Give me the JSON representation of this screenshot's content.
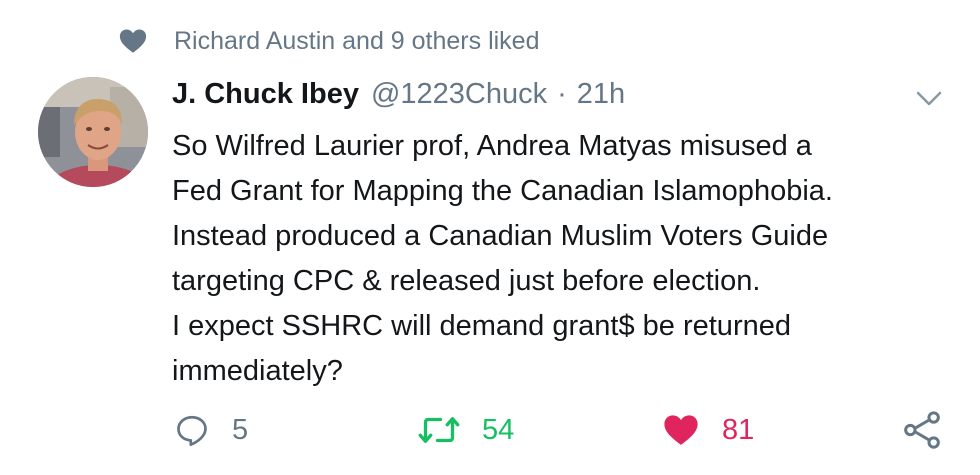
{
  "social_context": {
    "text": "Richard Austin and 9 others liked",
    "icon": "heart-icon"
  },
  "tweet": {
    "display_name": "J. Chuck Ibey",
    "handle": "@1223Chuck",
    "separator": "·",
    "time": "21h",
    "text_lines": [
      "So Wilfred Laurier prof, Andrea Matyas misused a",
      "Fed Grant for Mapping the Canadian Islamophobia.",
      "Instead produced a Canadian Muslim Voters Guide",
      "targeting CPC & released just before election.",
      "I expect SSHRC will demand grant$ be returned",
      "immediately?"
    ]
  },
  "actions": {
    "reply": {
      "icon": "reply-icon",
      "count": "5"
    },
    "retweet": {
      "icon": "retweet-icon",
      "count": "54"
    },
    "like": {
      "icon": "heart-icon",
      "count": "81"
    },
    "share": {
      "icon": "share-icon"
    }
  },
  "colors": {
    "text_primary": "#14171a",
    "text_secondary": "#657786",
    "retweet_green": "#17bf63",
    "like_red": "#e0245e"
  }
}
